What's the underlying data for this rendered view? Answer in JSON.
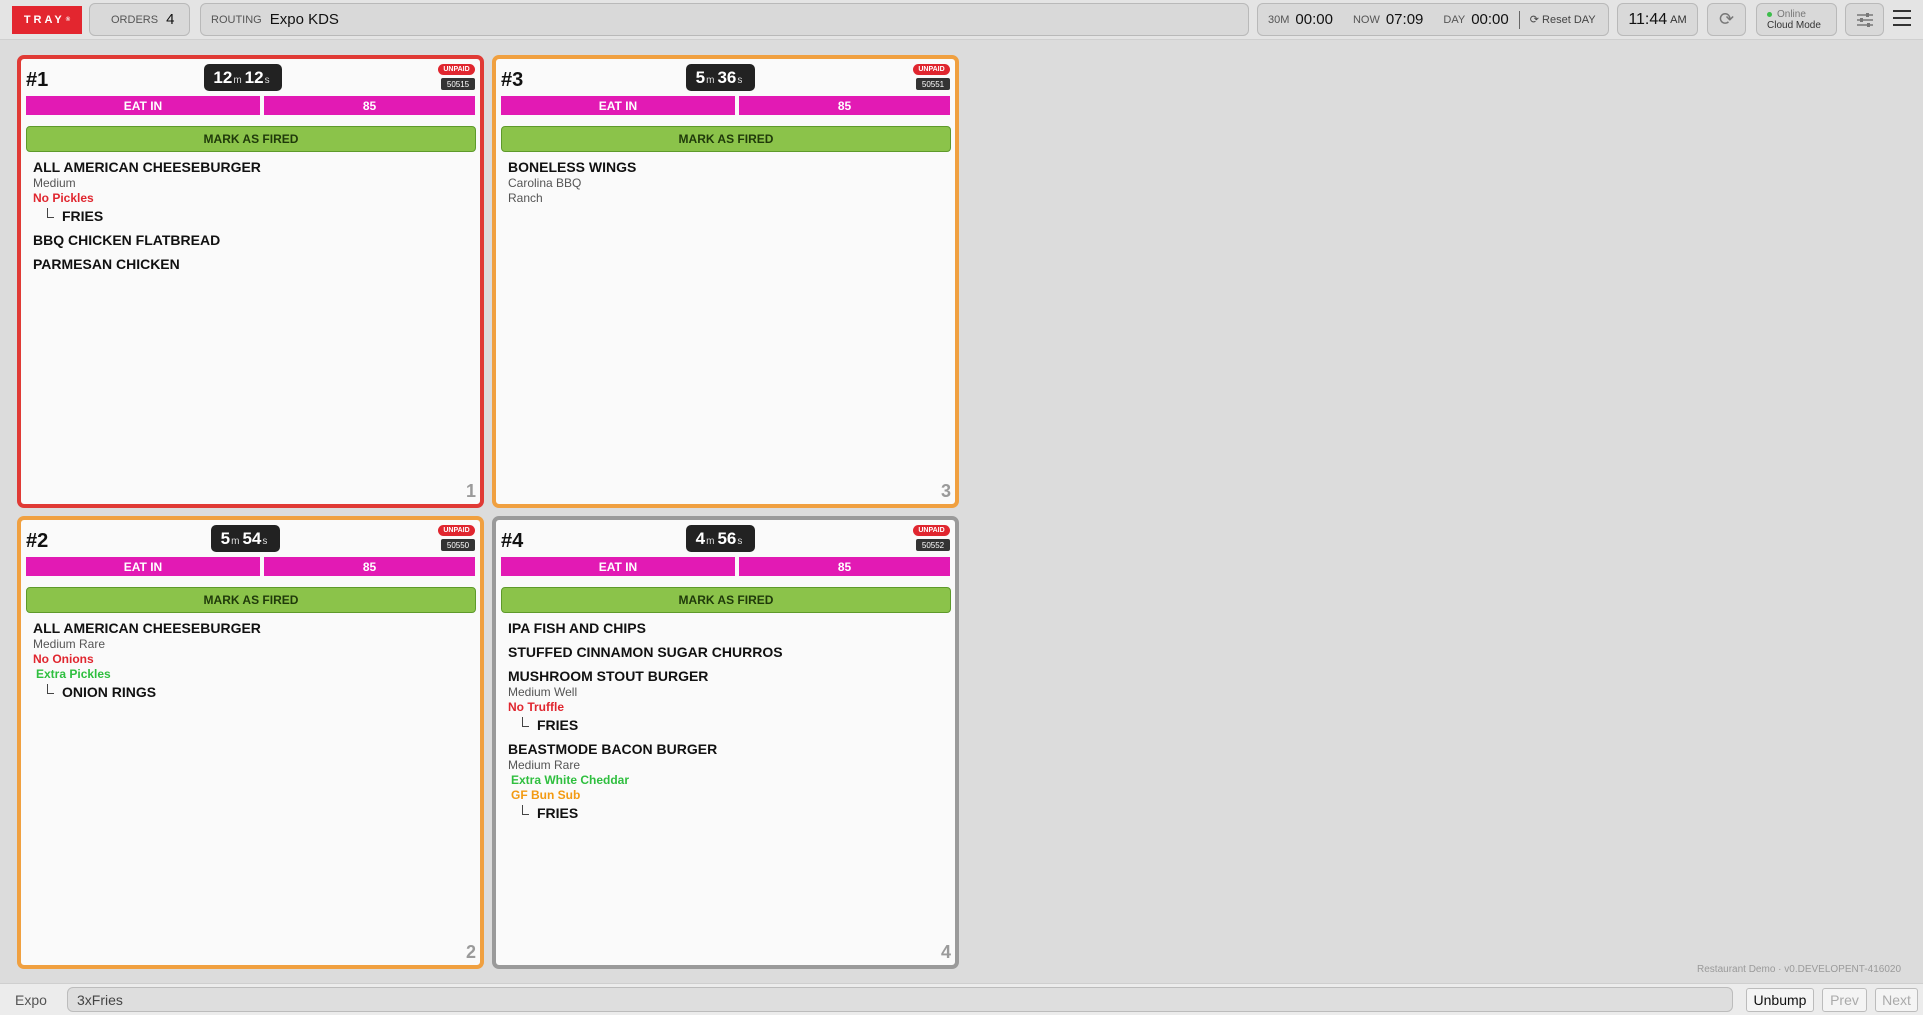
{
  "topbar": {
    "logo": "TRAY",
    "orders_label": "ORDERS",
    "orders_count": "4",
    "routing_label": "ROUTING",
    "routing_value": "Expo KDS",
    "t30_label": "30M",
    "t30_value": "00:00",
    "now_label": "NOW",
    "now_value": "07:09",
    "day_label": "DAY",
    "day_value": "00:00",
    "reset_label": "Reset DAY",
    "clock": "11:44",
    "ampm": "AM",
    "online_status": "Online",
    "mode": "Cloud Mode"
  },
  "cards": [
    {
      "number": "#1",
      "tm": "12",
      "ts": "12",
      "unpaid": "UNPAID",
      "ticket": "50515",
      "tag_a": "EAT IN",
      "tag_b": "85",
      "fire": "MARK AS FIRED",
      "position": "1",
      "items": [
        {
          "name": "ALL AMERICAN CHEESEBURGER",
          "mods": [
            {
              "text": "Medium",
              "type": "plain"
            },
            {
              "text": "No Pickles",
              "type": "red"
            }
          ],
          "subs": [
            "FRIES"
          ]
        },
        {
          "name": "BBQ CHICKEN FLATBREAD",
          "mods": [],
          "subs": []
        },
        {
          "name": "PARMESAN CHICKEN",
          "mods": [],
          "subs": []
        }
      ]
    },
    {
      "number": "#3",
      "tm": "5",
      "ts": "36",
      "unpaid": "UNPAID",
      "ticket": "50551",
      "tag_a": "EAT IN",
      "tag_b": "85",
      "fire": "MARK AS FIRED",
      "position": "3",
      "items": [
        {
          "name": "BONELESS WINGS",
          "mods": [
            {
              "text": "Carolina BBQ",
              "type": "plain"
            },
            {
              "text": "Ranch",
              "type": "plain"
            }
          ],
          "subs": []
        }
      ]
    },
    {
      "number": "#2",
      "tm": "5",
      "ts": "54",
      "unpaid": "UNPAID",
      "ticket": "50550",
      "tag_a": "EAT IN",
      "tag_b": "85",
      "fire": "MARK AS FIRED",
      "position": "2",
      "items": [
        {
          "name": "ALL AMERICAN CHEESEBURGER",
          "mods": [
            {
              "text": "Medium Rare",
              "type": "plain"
            },
            {
              "text": "No Onions",
              "type": "red"
            },
            {
              "text": "Extra Pickles",
              "type": "green"
            }
          ],
          "subs": [
            "ONION RINGS"
          ]
        }
      ]
    },
    {
      "number": "#4",
      "tm": "4",
      "ts": "56",
      "unpaid": "UNPAID",
      "ticket": "50552",
      "tag_a": "EAT IN",
      "tag_b": "85",
      "fire": "MARK AS FIRED",
      "position": "4",
      "items": [
        {
          "name": "IPA FISH AND CHIPS",
          "mods": [],
          "subs": []
        },
        {
          "name": "STUFFED CINNAMON SUGAR CHURROS",
          "mods": [],
          "subs": []
        },
        {
          "name": "MUSHROOM STOUT BURGER",
          "mods": [
            {
              "text": "Medium Well",
              "type": "plain"
            },
            {
              "text": "No Truffle",
              "type": "red"
            }
          ],
          "subs": [
            "FRIES"
          ]
        },
        {
          "name": "BEASTMODE BACON BURGER",
          "mods": [
            {
              "text": "Medium Rare",
              "type": "plain"
            },
            {
              "text": "Extra White Cheddar",
              "type": "green"
            },
            {
              "text": "GF Bun Sub",
              "type": "orange"
            }
          ],
          "subs": [
            "FRIES"
          ]
        }
      ]
    }
  ],
  "version": "Restaurant Demo · v0.DEVELOPENT-416020",
  "footer": {
    "station": "Expo",
    "search_value": "3xFries",
    "unbump": "Unbump",
    "prev": "Prev",
    "next": "Next"
  }
}
